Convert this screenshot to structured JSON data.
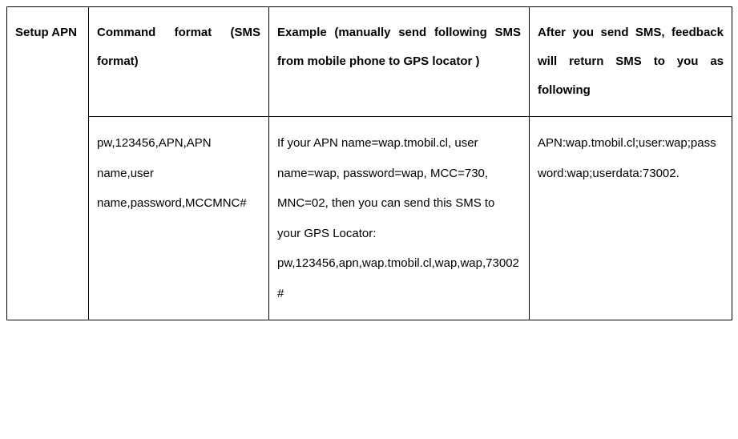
{
  "table": {
    "header": {
      "col0": "Setup APN",
      "col1": "Command format (SMS format)",
      "col2": "Example (manually send following SMS from mobile phone to GPS locator )",
      "col3": "After you send SMS, feedback will return SMS to you as following"
    },
    "row1": {
      "col1": "pw,123456,APN,APN name,user name,password,MCCMNC#",
      "col2": "If your APN name=wap.tmobil.cl, user name=wap, password=wap, MCC=730, MNC=02, then you can send this SMS to your GPS Locator: pw,123456,apn,wap.tmobil.cl,wap,wap,73002#",
      "col3": "APN:wap.tmobil.cl;user:wap;password:wap;userdata:73002."
    }
  }
}
